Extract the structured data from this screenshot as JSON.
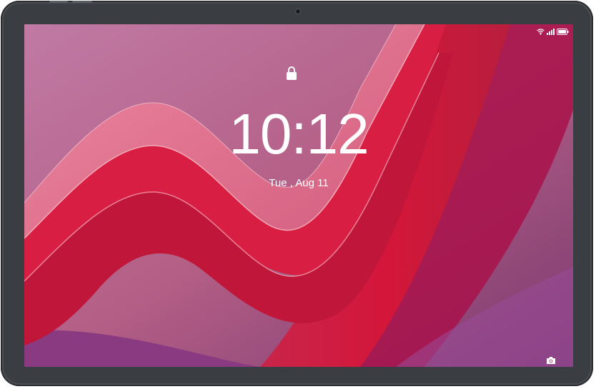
{
  "lockscreen": {
    "time": "10:12",
    "date": "Tue , Aug 11"
  },
  "status_bar": {
    "icons": [
      "wifi-icon",
      "signal-icon",
      "battery-icon"
    ]
  },
  "shortcuts": {
    "icons": [
      "lock-icon",
      "camera-icon"
    ]
  },
  "colors": {
    "bezel": "#3a3d42",
    "wallpaper_purple": "#b2668f",
    "wallpaper_red": "#d0183c",
    "text": "#ffffff"
  }
}
